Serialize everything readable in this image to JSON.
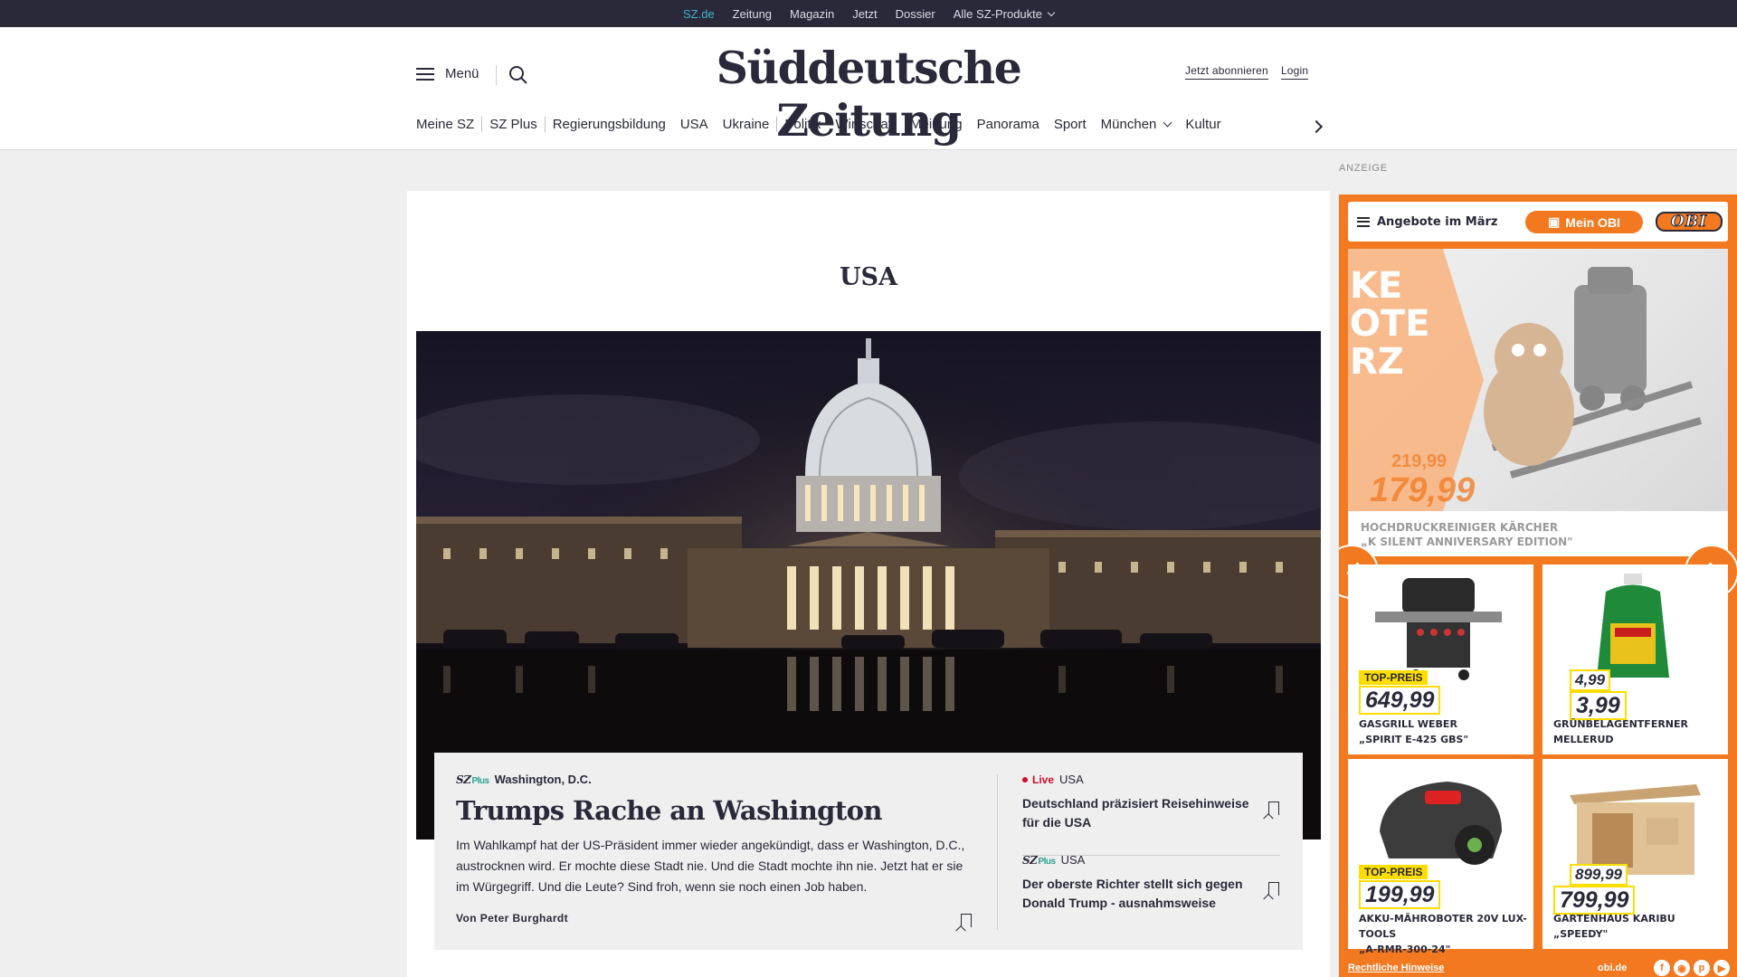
{
  "topbar": {
    "links": [
      "SZ.de",
      "Zeitung",
      "Magazin",
      "Jetzt",
      "Dossier",
      "Alle SZ-Produkte"
    ]
  },
  "header": {
    "menu_label": "Menü",
    "logo": "Süddeutsche Zeitung",
    "subscribe": "Jetzt abonnieren",
    "login": "Login"
  },
  "nav": {
    "items": [
      "Meine SZ",
      "SZ Plus",
      "Regierungsbildung",
      "USA",
      "Ukraine",
      "Politik",
      "Wirtschaft",
      "Meinung",
      "Panorama",
      "Sport",
      "München",
      "Kultur"
    ]
  },
  "section": {
    "title": "USA"
  },
  "lead": {
    "brand": "SZ",
    "brand_plus": "Plus",
    "location": "Washington, D.C.",
    "headline": "Trumps Rache an Washington",
    "teaser": "Im Wahlkampf hat der US-Präsident immer wieder angekündigt, dass er Washington, D.C., austrocknen wird. Er mochte diese Stadt nie. Und die Stadt mochte ihn nie. Jetzt hat er sie im Würgegriff. Und die Leute? Sind froh, wenn sie noch einen Job haben.",
    "byline": "Von Peter Burghardt"
  },
  "side_articles": [
    {
      "live": "Live",
      "category": "USA",
      "headline": "Deutschland präzisiert Reisehinweise für die USA"
    },
    {
      "brand": "SZ",
      "brand_plus": "Plus",
      "category": "USA",
      "headline": "Der oberste Richter stellt sich gegen Donald Trump - ausnahmsweise"
    }
  ],
  "ad": {
    "label": "ANZEIGE",
    "menu": "Angebote im März",
    "mein_obi": "Mein OBI",
    "logo": "OBI",
    "hero": {
      "headline": "KE\nOTE\nRZ",
      "old_price": "219,99",
      "new_price": "179,99",
      "caption": "HOCHDRUCKREINIGER KÄRCHER\n„K SILENT ANNIVERSARY EDITION\""
    },
    "products": [
      {
        "tag": "TOP-PREIS",
        "price": "649,99",
        "name": "GASGRILL WEBER\n„SPIRIT E-425 GBS\""
      },
      {
        "old_price": "4,99",
        "price": "3,99",
        "name": "GRÜNBELAGENTFERNER\nMELLERUD"
      },
      {
        "tag": "TOP-PREIS",
        "price": "199,99",
        "name": "AKKU-MÄHROBOTER 20V LUX-TOOLS\n„A-RMR-300-24\""
      },
      {
        "old_price": "899,99",
        "price": "799,99",
        "name": "GARTENHAUS KARIBU „SPEEDY\""
      }
    ],
    "footer": {
      "legal": "Rechtliche Hinweise",
      "domain": "obi.de"
    },
    "accent": "#f2791f"
  }
}
